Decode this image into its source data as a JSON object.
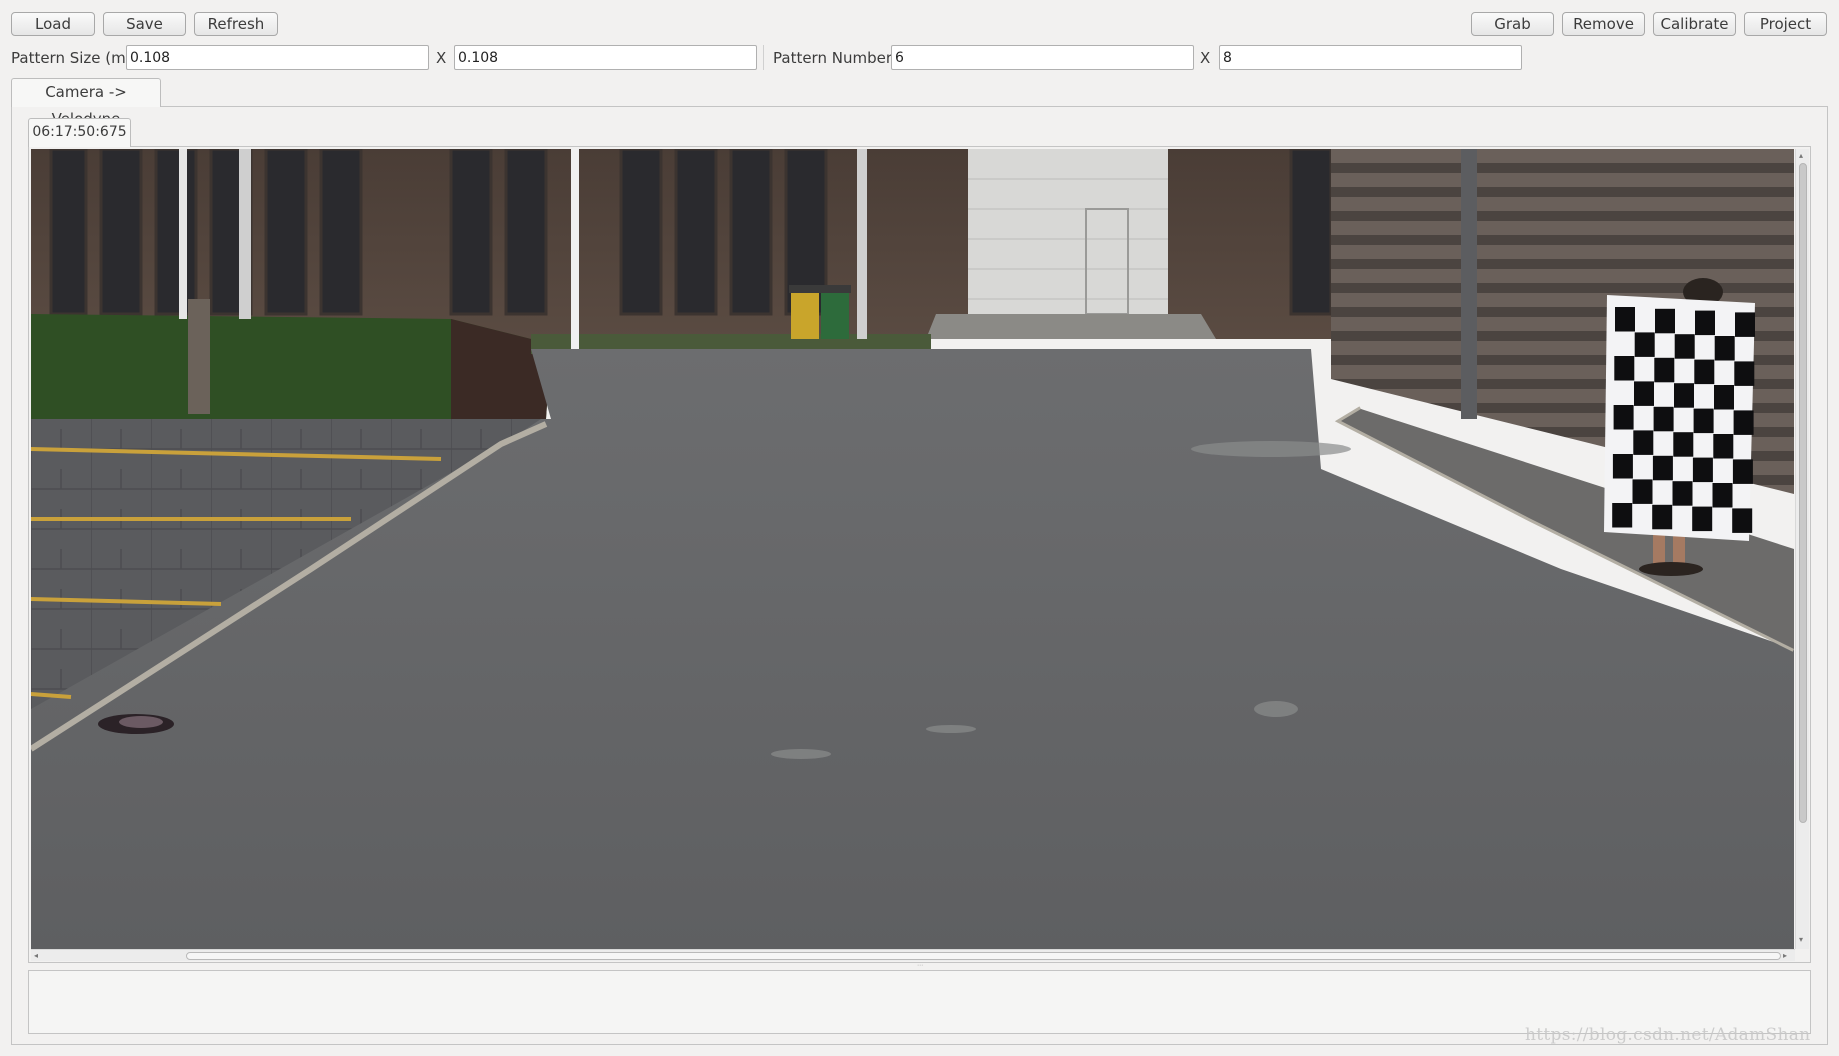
{
  "toolbar": {
    "load_label": "Load",
    "save_label": "Save",
    "refresh_label": "Refresh",
    "grab_label": "Grab",
    "remove_label": "Remove",
    "calibrate_label": "Calibrate",
    "project_label": "Project"
  },
  "pattern": {
    "size_label": "Pattern Size (m)",
    "size_width": "0.108",
    "size_x_label": "X",
    "size_height": "0.108",
    "number_label": "Pattern Number",
    "number_cols": "6",
    "number_x_label": "X",
    "number_rows": "8"
  },
  "tabs": {
    "main_tab_label": "Camera -> Velodyne",
    "frame_tab_label": "06:17:50:675"
  },
  "log": {
    "text": ""
  },
  "watermark": "https://blog.csdn.net/AdamShan",
  "icons": {
    "hscroll_left": "arrow-left-icon",
    "hscroll_right": "arrow-right-icon",
    "vscroll_up": "arrow-up-icon",
    "vscroll_down": "arrow-down-icon"
  }
}
